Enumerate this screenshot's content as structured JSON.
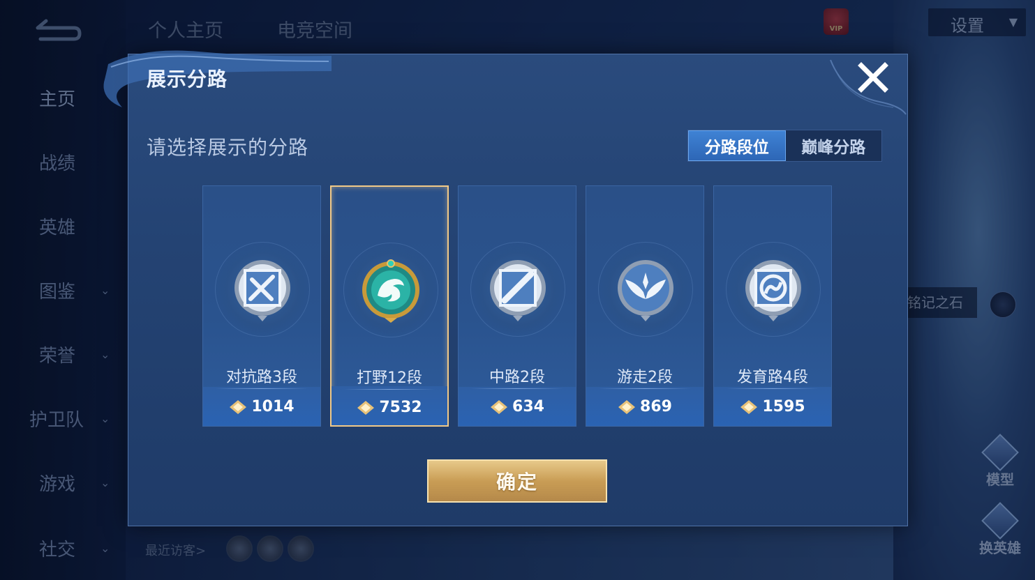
{
  "top_tabs": [
    "个人主页",
    "电竞空间"
  ],
  "sidebar": {
    "items": [
      {
        "label": "主页",
        "has_chevron": false
      },
      {
        "label": "战绩",
        "has_chevron": false
      },
      {
        "label": "英雄",
        "has_chevron": false
      },
      {
        "label": "图鉴",
        "has_chevron": true
      },
      {
        "label": "荣誉",
        "has_chevron": true
      },
      {
        "label": "护卫队",
        "has_chevron": true
      },
      {
        "label": "游戏",
        "has_chevron": true
      },
      {
        "label": "社交",
        "has_chevron": true
      }
    ]
  },
  "settings": {
    "label": "设置"
  },
  "background": {
    "stone_label": "铭记之石",
    "right_actions": [
      "模型",
      "换英雄"
    ],
    "visitors_label": "最近访客>"
  },
  "modal": {
    "title": "展示分路",
    "subtitle": "请选择展示的分路",
    "toggle": {
      "options": [
        "分路段位",
        "巅峰分路"
      ],
      "active_index": 0
    },
    "cards": [
      {
        "lane": "对抗路3段",
        "score": "1014",
        "emblem": "sword-emblem-icon",
        "selected": false
      },
      {
        "lane": "打野12段",
        "score": "7532",
        "emblem": "dragon-emblem-icon",
        "selected": true
      },
      {
        "lane": "中路2段",
        "score": "634",
        "emblem": "staff-emblem-icon",
        "selected": false
      },
      {
        "lane": "游走2段",
        "score": "869",
        "emblem": "wings-emblem-icon",
        "selected": false
      },
      {
        "lane": "发育路4段",
        "score": "1595",
        "emblem": "bow-emblem-icon",
        "selected": false
      }
    ],
    "confirm_label": "确定"
  },
  "colors": {
    "gold": "#f1c987",
    "accent_blue": "#3f82d4"
  }
}
